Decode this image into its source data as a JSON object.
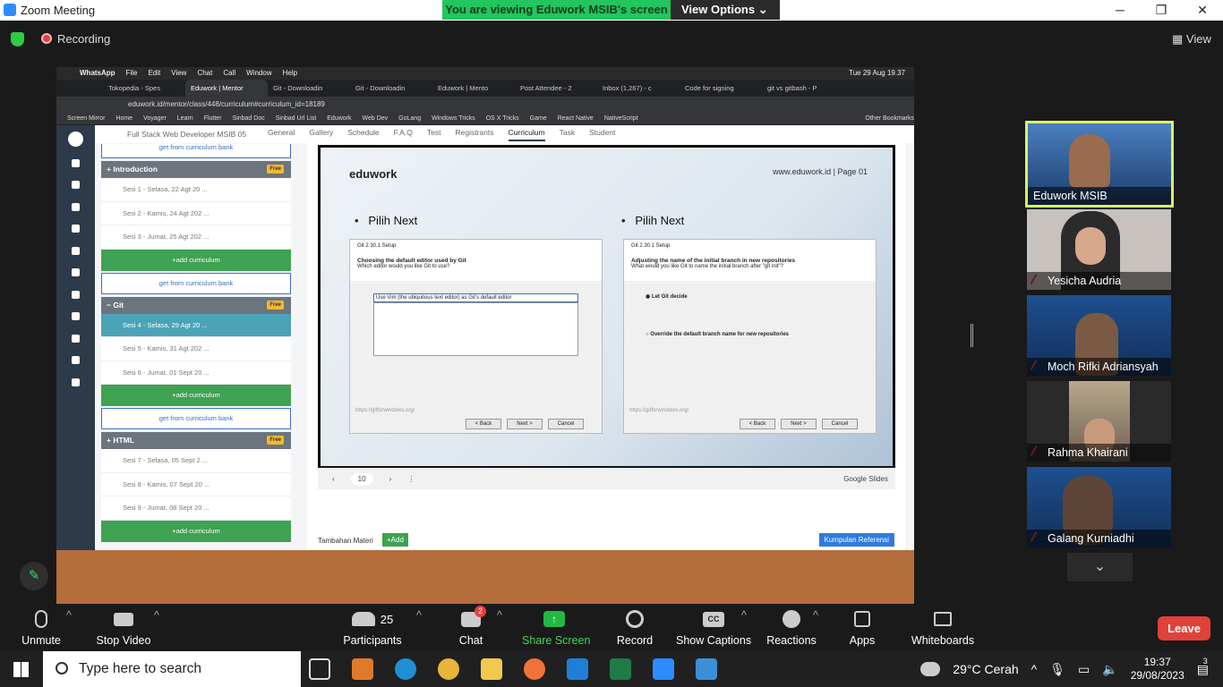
{
  "window": {
    "title": "Zoom Meeting",
    "min": "─",
    "max": "❐",
    "close": "✕"
  },
  "banner": {
    "message": "You are viewing Eduwork MSIB's screen",
    "options": "View Options"
  },
  "top": {
    "recording": "Recording",
    "view": "View"
  },
  "mac": {
    "menubar": [
      "WhatsApp",
      "File",
      "Edit",
      "View",
      "Chat",
      "Call",
      "Window",
      "Help"
    ],
    "clock": "Tue 29 Aug 19.37",
    "tabs": [
      "Tokopedia - Spes",
      "Eduwork | Mentor",
      "Git - Downloadin",
      "Git - Downloadin",
      "Eduwork | Mento",
      "Post Attendee - 2",
      "Inbox (1,267) - c",
      "Code for signing",
      "git vs gitbash - P"
    ],
    "address": "eduwork.id/mentor/class/448/curriculum#curriculum_id=18189",
    "bookmarks": [
      "Screen Mirror",
      "Home",
      "Voyager",
      "Learn",
      "Flutter",
      "Sinbad Doc",
      "Sinbad Url List",
      "Eduwork",
      "Web Dev",
      "GoLang",
      "Windows Tricks",
      "OS X Tricks",
      "Game",
      "React Native",
      "NativeScript",
      "Other Bookmarks"
    ]
  },
  "app": {
    "course": "Full Stack Web Developer MSIB 05",
    "nav": [
      "General",
      "Gallery",
      "Schedule",
      "F.A.Q",
      "Test",
      "Registrants",
      "Curriculum",
      "Task",
      "Student"
    ],
    "free": "Free",
    "get_bank": "get from curriculum bank",
    "add_curriculum": "+add curriculum",
    "sections": [
      {
        "title": "Introduction",
        "sesi": [
          "Sesi 1 - Selasa, 22 Agt 20 ...",
          "Sesi 2 - Kamis, 24 Agt 202 ...",
          "Sesi 3 - Jumat, 25 Agt 202 ..."
        ]
      },
      {
        "title": "Git",
        "sesi": [
          "Sesi 4 - Selasa, 29 Agt 20 ...",
          "Sesi 5 - Kamis, 31 Agt 202 ...",
          "Sesi 6 - Jumat, 01 Sept 20 ..."
        ]
      },
      {
        "title": "HTML",
        "sesi": [
          "Sesi 7 - Selasa, 05 Sept 2 ...",
          "Sesi 8 - Kamis, 07 Sept 20 ...",
          "Sesi 9 - Jumat, 08 Sept 20 ..."
        ]
      }
    ],
    "slide": {
      "brand": "eduwork",
      "page": "www.eduwork.id | Page 01",
      "pilih_left": "Pilih Next",
      "pilih_right": "Pilih Next",
      "dlg_title": "Git 2.30.1 Setup",
      "dlg_left_head": "Choosing the default editor used by Git",
      "dlg_left_sub": "Which editor would you like Git to use?",
      "dlg_left_select": "Use Vim (the ubiquitous text editor) as Git's default editor",
      "dlg_right_head": "Adjusting the name of the initial branch in new repositories",
      "dlg_right_sub": "What would you like Git to name the initial branch after \"git init\"?",
      "dlg_right_opt1": "Let Git decide",
      "dlg_right_opt2": "Override the default branch name for new repositories",
      "url": "https://gitforwindows.org/",
      "back": "< Back",
      "next": "Next >",
      "cancel": "Cancel"
    },
    "pager": {
      "page": "10",
      "service": "Google Slides"
    },
    "materi": "Tambahan Materi",
    "add": "+Add",
    "kumpulan": "Kumpulan Referensi"
  },
  "participants": [
    {
      "name": "Eduwork MSIB",
      "muted": false
    },
    {
      "name": "Yesicha Audria",
      "muted": true
    },
    {
      "name": "Moch Rifki Adriansyah",
      "muted": true
    },
    {
      "name": "Rahma Khairani",
      "muted": true
    },
    {
      "name": "Galang Kurniadhi",
      "muted": true
    }
  ],
  "toolbar": {
    "unmute": "Unmute",
    "stop_video": "Stop Video",
    "participants": "Participants",
    "participants_count": "25",
    "chat": "Chat",
    "chat_badge": "2",
    "share": "Share Screen",
    "record": "Record",
    "captions": "Show Captions",
    "reactions": "Reactions",
    "apps": "Apps",
    "whiteboards": "Whiteboards",
    "leave": "Leave"
  },
  "taskbar": {
    "search": "Type here to search",
    "weather": "29°C  Cerah",
    "time": "19:37",
    "date": "29/08/2023",
    "notif": "3"
  }
}
